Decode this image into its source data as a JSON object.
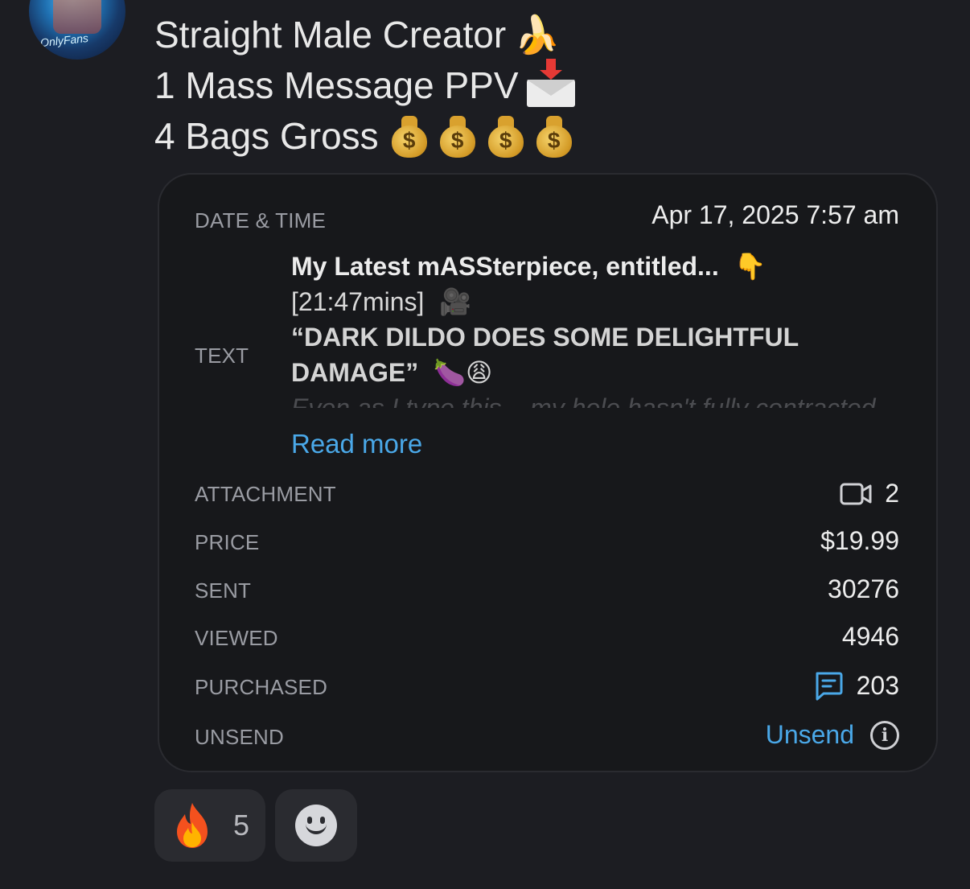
{
  "sender": {
    "avatar_caption": "OnlyFans"
  },
  "post": {
    "line1": "Straight Male Creator",
    "line1_emoji": "🍌",
    "line2": "1 Mass Message PPV",
    "line2_emoji": "envelope-with-arrow",
    "line3": "4 Bags Gross",
    "line3_bags": [
      "$",
      "$",
      "$",
      "$"
    ]
  },
  "details": {
    "date_label": "DATE & TIME",
    "date_value": "Apr 17, 2025 7:57 am",
    "text_label": "TEXT",
    "text_title": "My Latest mASSterpiece, entitled...",
    "text_title_emoji": "👇",
    "text_duration": "[21:47mins]",
    "text_duration_emoji": "🎥",
    "text_quote": "“DARK DILDO DOES SOME DELIGHTFUL DAMAGE”",
    "text_quote_emoji": "🍆😩",
    "text_faded": "Even as I type this... my hole hasn't fully contracted",
    "read_more": "Read more",
    "attachment_label": "ATTACHMENT",
    "attachment_count": "2",
    "price_label": "PRICE",
    "price_value": "$19.99",
    "sent_label": "SENT",
    "sent_value": "30276",
    "viewed_label": "VIEWED",
    "viewed_value": "4946",
    "purchased_label": "PURCHASED",
    "purchased_value": "203",
    "unsend_label": "UNSEND",
    "unsend_link": "Unsend"
  },
  "reactions": {
    "fire_count": "5"
  },
  "colors": {
    "background": "#1c1d22",
    "card": "#17181b",
    "link": "#4aa8e8",
    "label": "#9a9ca3"
  }
}
